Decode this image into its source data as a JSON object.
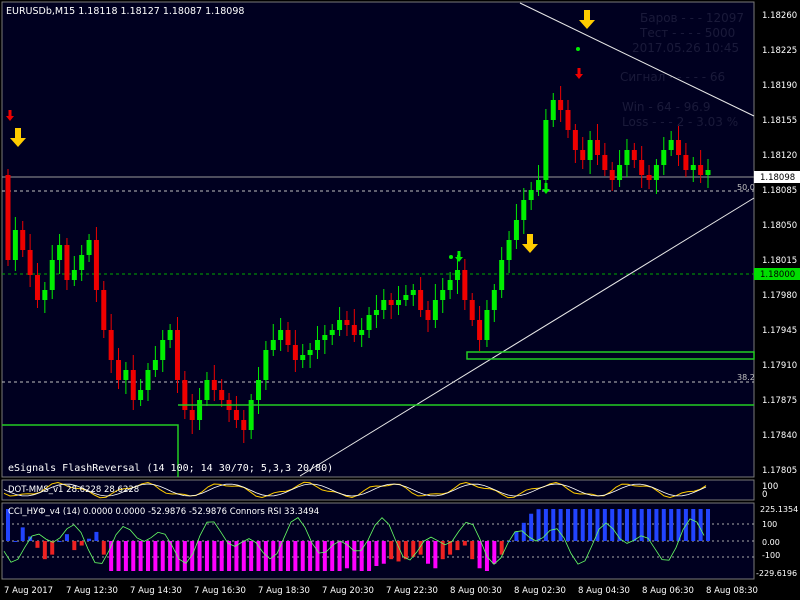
{
  "header": {
    "symbol_line": "EURUSDb,M15  1.18118 1.18127 1.18087 1.18098"
  },
  "stats_panel": {
    "lines": [
      "Баров - - - 12097",
      "Тест - - - - 5000",
      "2017.05.26 10:45",
      "Сигнал - - - - - 66",
      "Win - 64 - 96.9",
      "Loss - - - 2 - 3.03 %"
    ]
  },
  "price_axis": {
    "labels": [
      "1.18260",
      "1.18225",
      "1.18190",
      "1.18155",
      "1.18120",
      "1.18085",
      "1.18050",
      "1.18015",
      "1.17980",
      "1.17945",
      "1.17910",
      "1.17875",
      "1.17840",
      "1.17805"
    ],
    "current_price": "1.18098",
    "level_price": "1.18000"
  },
  "fib_labels": {
    "upper": "50.0",
    "lower": "38.2"
  },
  "indicator_label": "eSignals FlashReversal (14 100; 14 30/70; 5,3,3 20/80)",
  "subwindow1": {
    "title": "DOT-MMS_v1 28.6228 28.6228",
    "scale": [
      "100",
      "0"
    ]
  },
  "subwindow2": {
    "title": "CCI_НУФ_v4 (14) 0.0000 0.0000 -52.9876 -52.9876  Connors RSI 33.3494",
    "scale": [
      "225.1354",
      "100",
      "0.00",
      "-100",
      "-229.6196"
    ]
  },
  "time_axis": {
    "labels": [
      "7 Aug 2017",
      "7 Aug 12:30",
      "7 Aug 14:30",
      "7 Aug 16:30",
      "7 Aug 18:30",
      "7 Aug 20:30",
      "7 Aug 22:30",
      "8 Aug 00:30",
      "8 Aug 02:30",
      "8 Aug 04:30",
      "8 Aug 06:30",
      "8 Aug 08:30"
    ]
  },
  "colors": {
    "bull": "#00ee00",
    "bear": "#ee0000",
    "arrow_sell": "#ffcc00",
    "grid": "#c0c0c0",
    "panel_bg": "#000020",
    "axis_bg": "#000000",
    "cci_pos": "#2244ff",
    "cci_neg": "#ee2222",
    "cci_strong": "#ff00ff"
  }
}
